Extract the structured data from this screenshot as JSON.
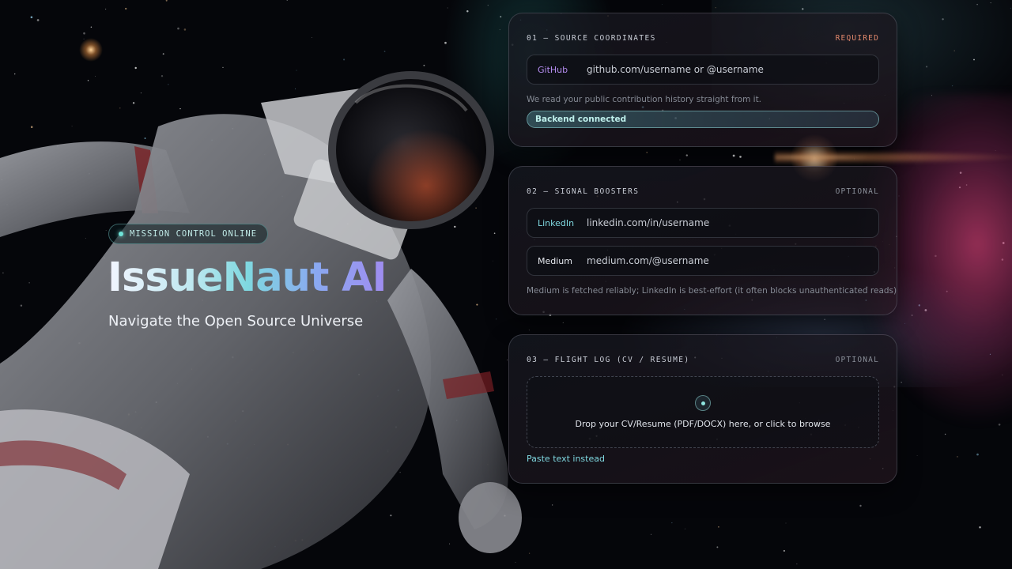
{
  "hero": {
    "badge": "MISSION CONTROL ONLINE",
    "title": "IssueNaut AI",
    "subtitle": "Navigate the Open Source Universe"
  },
  "panels": [
    {
      "title": "01 — SOURCE COORDINATES",
      "tag": "REQUIRED",
      "fields": [
        {
          "label": "GitHub",
          "placeholder": "github.com/username or @username",
          "label_color": "#b48cf0"
        }
      ],
      "hint": "We read your public contribution history straight from it.",
      "status": "Backend connected"
    },
    {
      "title": "02 — SIGNAL BOOSTERS",
      "tag": "OPTIONAL",
      "fields": [
        {
          "label": "LinkedIn",
          "placeholder": "linkedin.com/in/username",
          "label_color": "#7fd8e0"
        },
        {
          "label": "Medium",
          "placeholder": "medium.com/@username",
          "label_color": "#e6e9ef"
        }
      ],
      "hint": "Medium is fetched reliably; LinkedIn is best-effort (it often blocks unauthenticated reads)."
    },
    {
      "title": "03 — FLIGHT LOG (CV / RESUME)",
      "tag": "OPTIONAL",
      "dropzone_text": "Drop your CV/Resume (PDF/DOCX) here, or click to browse",
      "paste_link": "Paste text instead"
    }
  ],
  "colors": {
    "accent": "#7fd8e0",
    "required": "#e0876b",
    "background": "#05060a"
  },
  "icons": {
    "badge": "status-dot-icon",
    "dropzone": "upload-icon"
  }
}
